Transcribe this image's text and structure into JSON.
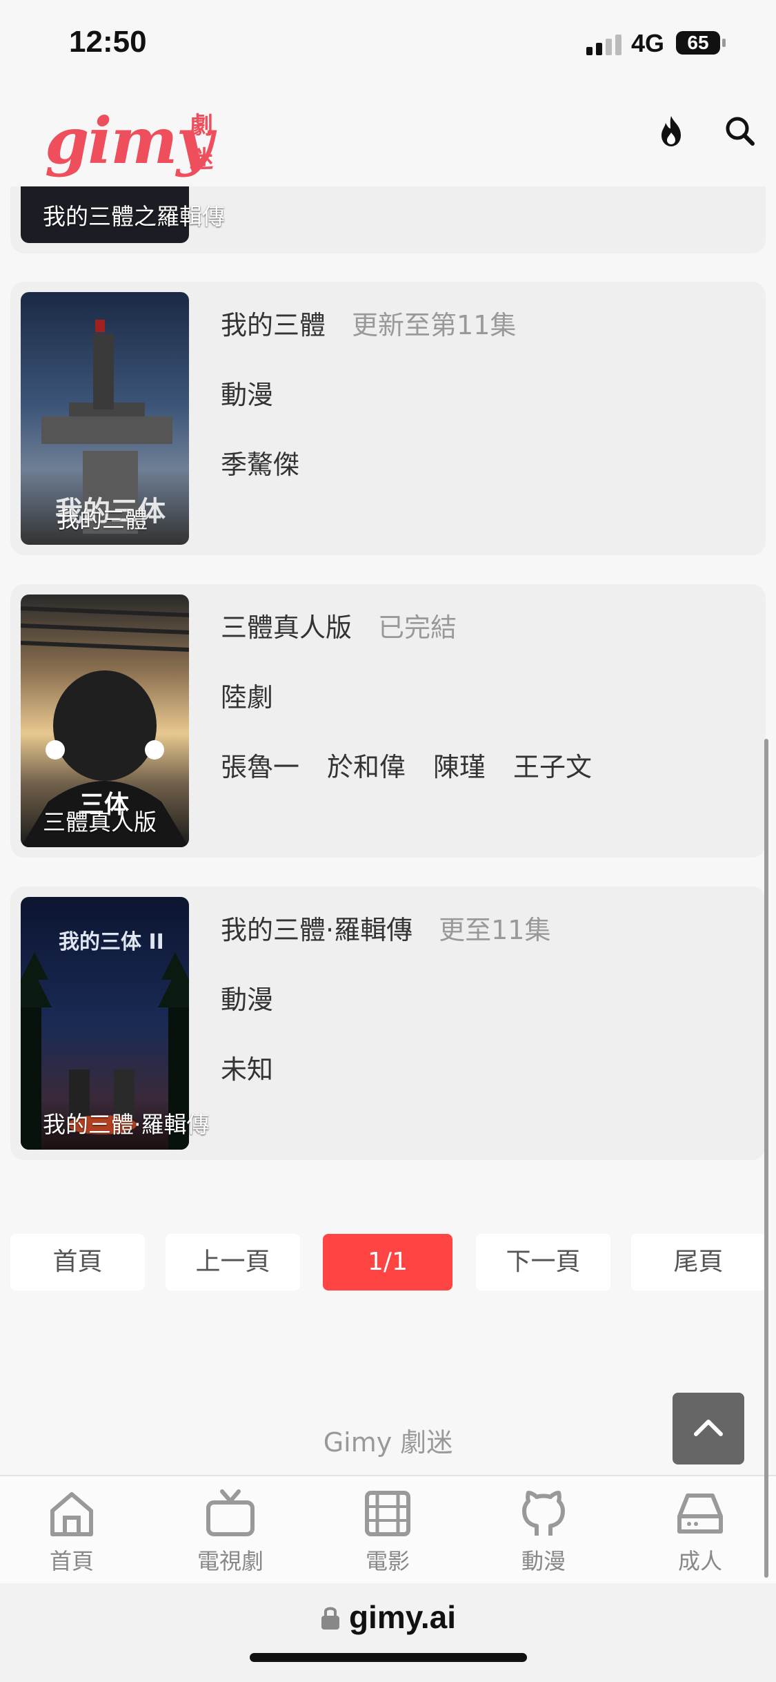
{
  "status_bar": {
    "time": "12:50",
    "network": "4G",
    "battery": "65"
  },
  "header": {
    "logo_text": "gimy",
    "logo_sub": "劇迷",
    "icons": [
      "fire-icon",
      "search-icon"
    ]
  },
  "partial_card": {
    "poster_label": "我的三體之羅輯傳"
  },
  "cards": [
    {
      "title": "我的三體",
      "status": "更新至第11集",
      "category": "動漫",
      "actors": [
        "季驁傑"
      ],
      "poster_label": "我的三體",
      "poster_art_text": "我的三体"
    },
    {
      "title": "三體真人版",
      "status": "已完結",
      "category": "陸劇",
      "actors": [
        "張魯一",
        "於和偉",
        "陳瑾",
        "王子文"
      ],
      "poster_label": "三體真人版",
      "poster_art_text": "三体"
    },
    {
      "title": "我的三體·羅輯傳",
      "status": "更至11集",
      "category": "動漫",
      "actors": [
        "未知"
      ],
      "poster_label": "我的三體·羅輯傳",
      "poster_art_text": "我的三体 II"
    }
  ],
  "pagination": {
    "first": "首頁",
    "prev": "上一頁",
    "current": "1/1",
    "next": "下一頁",
    "last": "尾頁"
  },
  "footer": {
    "text": "Gimy 劇迷"
  },
  "bottom_nav": [
    {
      "label": "首頁",
      "icon": "home-icon"
    },
    {
      "label": "電視劇",
      "icon": "tv-icon"
    },
    {
      "label": "電影",
      "icon": "film-icon"
    },
    {
      "label": "動漫",
      "icon": "github-icon"
    },
    {
      "label": "成人",
      "icon": "drive-icon"
    }
  ],
  "browser": {
    "url": "gimy.ai"
  },
  "colors": {
    "brand": "#ef4e5d",
    "active_page": "#ff4444"
  }
}
